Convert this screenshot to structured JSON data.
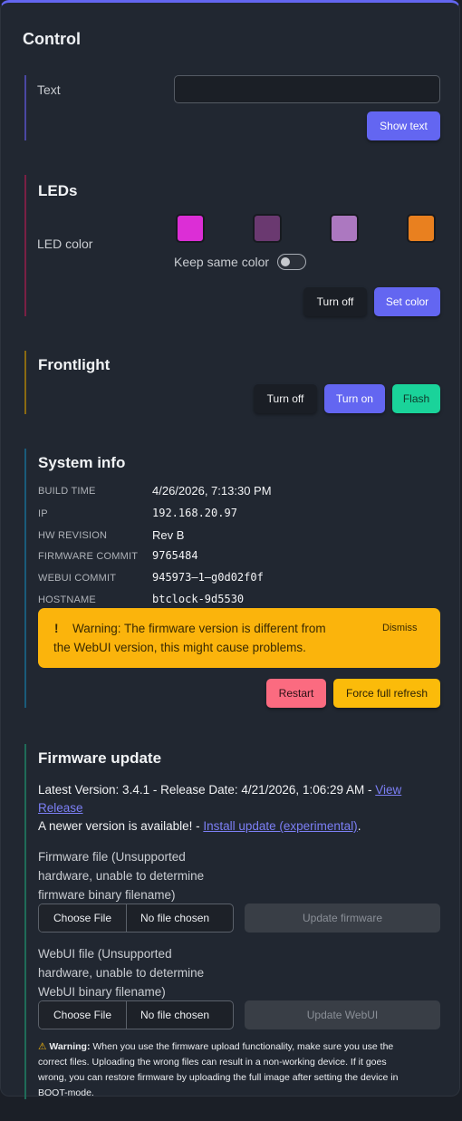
{
  "title": "Control",
  "text_section": {
    "label": "Text",
    "input_value": "",
    "show_button": "Show text"
  },
  "leds": {
    "heading": "LEDs",
    "label": "LED color",
    "swatches": [
      "#dc2ed6",
      "#6a3970",
      "#ac78c0",
      "#e9801f"
    ],
    "keep_same_label": "Keep same color",
    "keep_same_on": false,
    "turn_off": "Turn off",
    "set_color": "Set color"
  },
  "frontlight": {
    "heading": "Frontlight",
    "turn_off": "Turn off",
    "turn_on": "Turn on",
    "flash": "Flash"
  },
  "system": {
    "heading": "System info",
    "rows": [
      {
        "key": "BUILD TIME",
        "value": "4/26/2026, 7:13:30 PM"
      },
      {
        "key": "IP",
        "value": "192.168.20.97"
      },
      {
        "key": "HW REVISION",
        "value": "Rev B"
      },
      {
        "key": "FIRMWARE COMMIT",
        "value": "9765484"
      },
      {
        "key": "WEBUI COMMIT",
        "value": "945973–1–g0d02f0f"
      },
      {
        "key": "HOSTNAME",
        "value": "btclock-9d5530"
      }
    ],
    "warning_line1": "Warning: The firmware version is different from",
    "warning_line2": "the WebUI version, this might cause problems.",
    "dismiss": "Dismiss",
    "restart": "Restart",
    "force_refresh": "Force full refresh"
  },
  "firmware": {
    "heading": "Firmware update",
    "latest_prefix": "Latest Version: 3.4.1 - Release Date: 4/21/2026, 1:06:29 AM - ",
    "view_link_1": "View",
    "view_link_2": "Release",
    "newer_prefix": "A newer version is available! - ",
    "install_link": "Install update (experimental)",
    "newer_suffix": ".",
    "fw_file_label_1": "Firmware file (Unsupported",
    "fw_file_label_2": "hardware, unable to determine",
    "fw_file_label_3": "firmware binary filename)",
    "choose_file": "Choose File",
    "no_file": "No file chosen",
    "update_firmware": "Update firmware",
    "webui_file_label_1": "WebUI file (Unsupported",
    "webui_file_label_2": "hardware, unable to determine",
    "webui_file_label_3": "WebUI binary filename)",
    "update_webui": "Update WebUI",
    "note_bold": "Warning:",
    "note_line1": " When you use the firmware upload functionality, make sure you use the",
    "note_line2": "correct files. Uploading the wrong files can result in a non-working device. If it goes",
    "note_line3": "wrong, you can restore firmware by uploading the full image after setting the device in",
    "note_line4": "BOOT-mode."
  },
  "colors": {
    "accent": "#6366f1",
    "text_border": "#4a47a3",
    "leds_border": "#7a2044",
    "frontlight_border": "#8a6a12",
    "system_border": "#1a5b7a",
    "firmware_border": "#1f6b58"
  }
}
